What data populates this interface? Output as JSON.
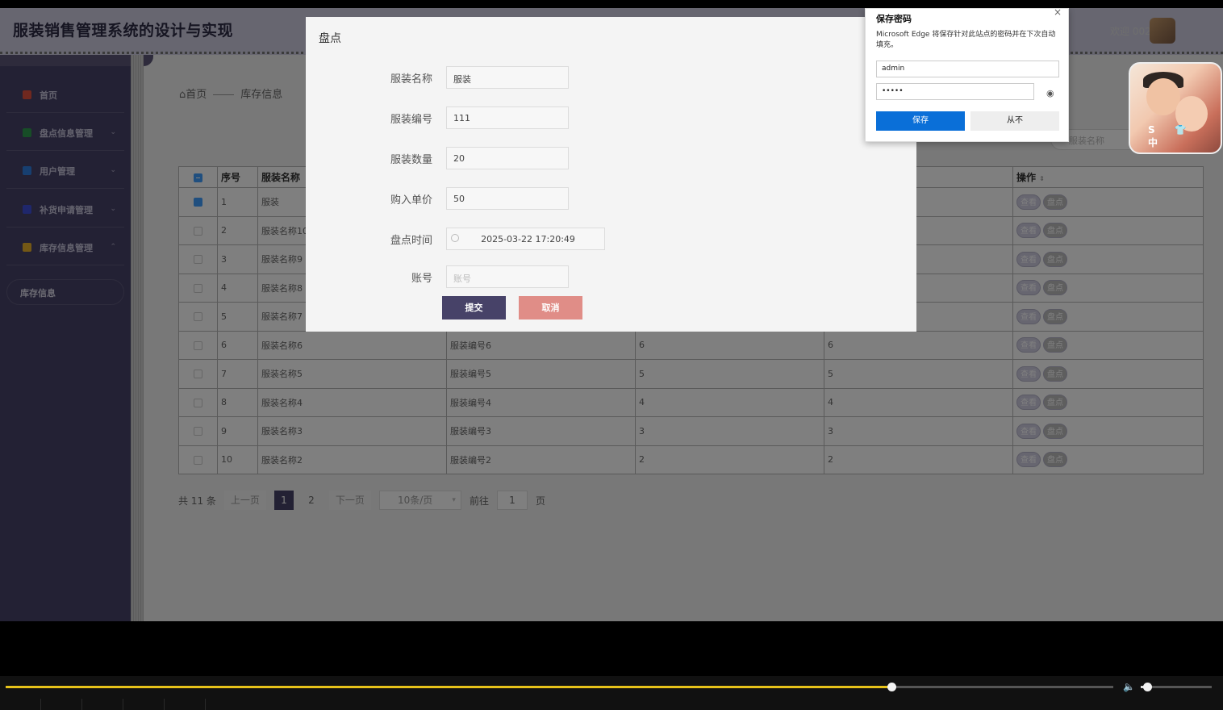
{
  "header": {
    "title": "服装销售管理系统的设计与实现",
    "welcome": "欢迎 002"
  },
  "sidebar": {
    "items": [
      {
        "label": "首页",
        "color": "#e0503f",
        "has_chevron": false
      },
      {
        "label": "盘点信息管理",
        "color": "#2e9a4e",
        "has_chevron": true
      },
      {
        "label": "用户管理",
        "color": "#2f7fe0",
        "has_chevron": true
      },
      {
        "label": "补货申请管理",
        "color": "#3e4fd8",
        "has_chevron": true
      },
      {
        "label": "库存信息管理",
        "color": "#e8b02a",
        "has_chevron": true
      }
    ],
    "sub_item": "库存信息"
  },
  "breadcrumb": {
    "home": "首页",
    "current": "库存信息"
  },
  "search": {
    "placeholder": "服装名称"
  },
  "table": {
    "headers": [
      "序号",
      "服装名称",
      "",
      "",
      "",
      "操作"
    ],
    "view_label": "查看",
    "check_label": "盘点",
    "rows": [
      {
        "no": "1",
        "name": "服装",
        "code": "",
        "qty": "",
        "price": "",
        "checked": true
      },
      {
        "no": "2",
        "name": "服装名称10",
        "code": "",
        "qty": "",
        "price": "",
        "checked": false
      },
      {
        "no": "3",
        "name": "服装名称9",
        "code": "",
        "qty": "",
        "price": "",
        "checked": false
      },
      {
        "no": "4",
        "name": "服装名称8",
        "code": "",
        "qty": "",
        "price": "",
        "checked": false
      },
      {
        "no": "5",
        "name": "服装名称7",
        "code": "",
        "qty": "",
        "price": "",
        "checked": false
      },
      {
        "no": "6",
        "name": "服装名称6",
        "code": "服装编号6",
        "qty": "6",
        "price": "6",
        "checked": false
      },
      {
        "no": "7",
        "name": "服装名称5",
        "code": "服装编号5",
        "qty": "5",
        "price": "5",
        "checked": false
      },
      {
        "no": "8",
        "name": "服装名称4",
        "code": "服装编号4",
        "qty": "4",
        "price": "4",
        "checked": false
      },
      {
        "no": "9",
        "name": "服装名称3",
        "code": "服装编号3",
        "qty": "3",
        "price": "3",
        "checked": false
      },
      {
        "no": "10",
        "name": "服装名称2",
        "code": "服装编号2",
        "qty": "2",
        "price": "2",
        "checked": false
      }
    ]
  },
  "pager": {
    "total": "共 11 条",
    "prev": "上一页",
    "pages": [
      "1",
      "2"
    ],
    "active_page": "1",
    "next": "下一页",
    "page_size": "10条/页",
    "goto_label": "前往",
    "goto_value": "1",
    "page_suffix": "页"
  },
  "dialog": {
    "title": "盘点",
    "fields": [
      {
        "label": "服装名称",
        "value": "服装",
        "placeholder": ""
      },
      {
        "label": "服装编号",
        "value": "111",
        "placeholder": ""
      },
      {
        "label": "服装数量",
        "value": "20",
        "placeholder": ""
      },
      {
        "label": "购入单价",
        "value": "50",
        "placeholder": ""
      },
      {
        "label": "盘点时间",
        "value": "2025-03-22 17:20:49",
        "placeholder": ""
      },
      {
        "label": "账号",
        "value": "",
        "placeholder": "账号"
      }
    ],
    "submit": "提交",
    "cancel": "取消"
  },
  "password_popup": {
    "title": "保存密码",
    "close": "×",
    "description": "Microsoft Edge 将保存针对此站点的密码并在下次自动填充。",
    "username": "admin",
    "password_mask": "•••••",
    "save": "保存",
    "never": "从不"
  },
  "webcam_badge": "S 👕 中",
  "player": {
    "progress": 0.8,
    "volume": 0.1
  }
}
